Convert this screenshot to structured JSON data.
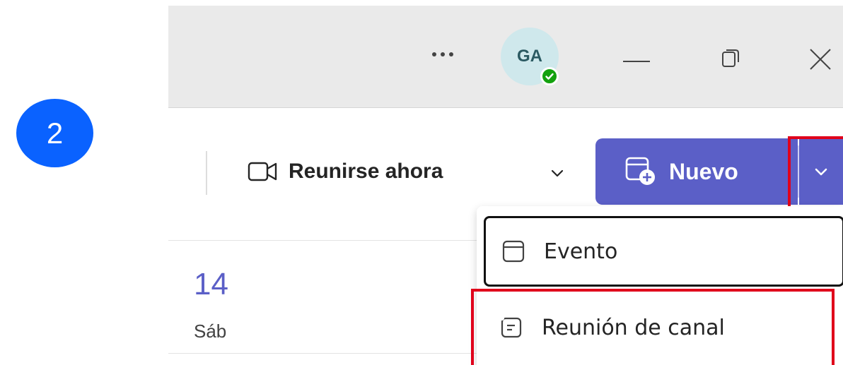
{
  "step": {
    "number": "2",
    "color": "#0a62ff"
  },
  "titlebar": {
    "avatar_initials": "GA",
    "presence_color": "#13a10e",
    "icons": [
      "more-icon",
      "minimize-icon",
      "restore-icon",
      "close-icon"
    ]
  },
  "toolbar": {
    "meet_now_label": "Reunirse ahora",
    "new_label": "Nuevo",
    "accent": "#5b5fc7"
  },
  "calendar": {
    "date_number": "14",
    "day_label": "Sáb"
  },
  "new_menu": {
    "items": [
      {
        "label": "Evento",
        "icon": "calendar-icon"
      },
      {
        "label": "Reunión de canal",
        "icon": "channel-meeting-icon"
      }
    ]
  },
  "highlight_color": "#e0001b"
}
